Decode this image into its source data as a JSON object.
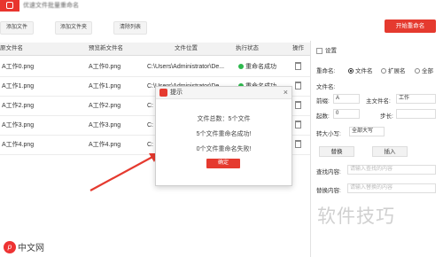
{
  "app": {
    "title": "优速文件批量重命名"
  },
  "toolbar": {
    "add_file": "添加文件",
    "add_folder": "添加文件夹",
    "clear_list": "清除列表",
    "rename": "开始重命名"
  },
  "table": {
    "columns": [
      "原文件名",
      "预览新文件名",
      "文件位置",
      "执行状态",
      "操作"
    ],
    "rows": [
      {
        "orig": "A工作0.png",
        "new": "A工作0.png",
        "path": "C:\\Users\\Administrator\\De...",
        "status": "重命名成功"
      },
      {
        "orig": "A工作1.png",
        "new": "A工作1.png",
        "path": "C:\\Users\\Administrator\\De...",
        "status": "重命名成功"
      },
      {
        "orig": "A工作2.png",
        "new": "A工作2.png",
        "path": "C:",
        "status": ""
      },
      {
        "orig": "A工作3.png",
        "new": "A工作3.png",
        "path": "C:",
        "status": ""
      },
      {
        "orig": "A工作4.png",
        "new": "A工作4.png",
        "path": "C:",
        "status": ""
      }
    ]
  },
  "settings": {
    "header": "设置",
    "rename_label": "重命名:",
    "opt_filename": "文件名",
    "opt_extension": "扩展名",
    "opt_all": "全部",
    "filename_label": "文件名:",
    "prefix_label": "前缀:",
    "prefix_value": "A",
    "main_label": "主文件名:",
    "main_value": "工作",
    "start_label": "起数:",
    "start_value": "0",
    "step_label": "步长:",
    "case_label": "转大小写:",
    "case_value": "全部大写",
    "replace_button": "替换",
    "insert_button": "插入",
    "find_label": "查找内容:",
    "find_placeholder": "请输入查找的内容",
    "replace_label": "替换内容:",
    "replace_placeholder": "请输入替换的内容"
  },
  "dialog": {
    "title": "提示",
    "close": "×",
    "total": "文件总数：5个文件",
    "success": "5个文件重命名成功!",
    "fail": "0个文件重命名失败!",
    "ok": "确定"
  },
  "watermark": "软件技巧",
  "brand": {
    "icon": "p",
    "text": "中文网"
  },
  "colors": {
    "accent": "#e53a2f",
    "success": "#2db84d"
  }
}
